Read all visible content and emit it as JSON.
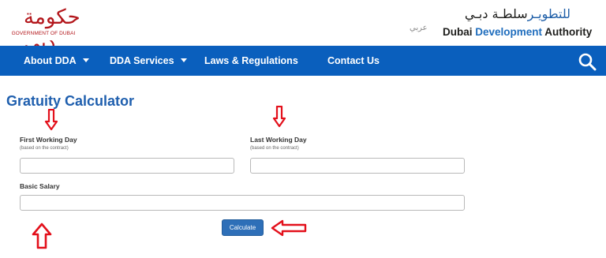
{
  "header": {
    "gov_logo_arabic": "حكومة دبي",
    "gov_logo_text": "GOVERNMENT OF DUBAI",
    "lang_switch": "عربي",
    "dda_logo_arabic_black": "سلطـة دبـي",
    "dda_logo_arabic_blue": " للتطويـر",
    "dda_logo_en_black": "Dubai ",
    "dda_logo_en_blue": "Development",
    "dda_logo_en_black2": " Authority"
  },
  "nav": {
    "items": [
      {
        "label": "About DDA",
        "has_dropdown": true
      },
      {
        "label": "DDA Services",
        "has_dropdown": true
      },
      {
        "label": "Laws & Regulations",
        "has_dropdown": false
      },
      {
        "label": "Contact Us",
        "has_dropdown": false
      }
    ],
    "search_icon": "search-icon"
  },
  "main": {
    "title": "Gratuity Calculator",
    "first_day": {
      "label": "First Working Day",
      "hint": "(based on the contract)",
      "value": ""
    },
    "last_day": {
      "label": "Last Working Day",
      "hint": "(based on the contract)",
      "value": ""
    },
    "salary": {
      "label": "Basic Salary",
      "value": ""
    },
    "calculate_label": "Calculate"
  },
  "annotations": {
    "arrow_color": "#e3101b"
  },
  "colors": {
    "nav_bg": "#0a5fbd",
    "title": "#1f5fae",
    "button": "#2e6fb8",
    "logo_red": "#b3161b"
  }
}
